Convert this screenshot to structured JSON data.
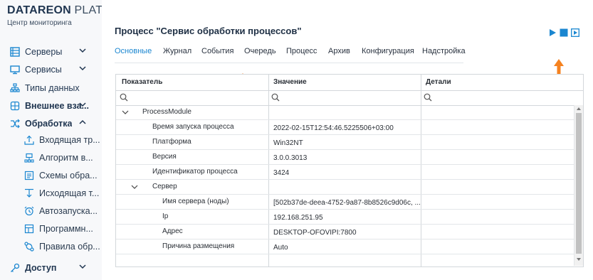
{
  "brand": {
    "name_bold": "DATAREON",
    "name_rest": "PLATF",
    "subtitle": "Центр мониторинга"
  },
  "sidebar": {
    "items": [
      {
        "label": "Серверы",
        "icon": "server-list-icon",
        "chevron": "down"
      },
      {
        "label": "Сервисы",
        "icon": "monitor-icon",
        "chevron": "down"
      },
      {
        "label": "Типы данных",
        "icon": "hierarchy-icon"
      },
      {
        "label": "Внешнее вза...",
        "icon": "puzzle-icon",
        "chevron": "down"
      },
      {
        "label": "Обработка",
        "icon": "shuffle-icon",
        "chevron": "up"
      },
      {
        "label": "Доступ",
        "icon": "key-icon",
        "chevron": "down"
      }
    ],
    "processing_children": [
      {
        "label": "Входящая тр...",
        "icon": "upload-icon"
      },
      {
        "label": "Алгоритм в...",
        "icon": "algorithm-icon"
      },
      {
        "label": "Схемы обра...",
        "icon": "scheme-icon"
      },
      {
        "label": "Исходящая т...",
        "icon": "download-icon"
      },
      {
        "label": "Автозапуска...",
        "icon": "alarm-icon"
      },
      {
        "label": "Программн...",
        "icon": "grid-icon"
      },
      {
        "label": "Правила обр...",
        "icon": "rules-icon"
      }
    ]
  },
  "page": {
    "title": "Процесс \"Сервис обработки процессов\""
  },
  "tabs": [
    "Основные",
    "Журнал",
    "События",
    "Очередь",
    "Процесс",
    "Архив",
    "Конфигурация",
    "Надстройка"
  ],
  "active_tab": "Основные",
  "controls": {
    "play": "play-icon",
    "stop": "stop-icon",
    "step": "step-play-icon"
  },
  "grid": {
    "columns": [
      "Показатель",
      "Значение",
      "Детали"
    ],
    "rows": [
      {
        "indicator": "ProcessModule",
        "value": "",
        "level": 0,
        "expandable": true
      },
      {
        "indicator": "Время запуска процесса",
        "value": "2022-02-15T12:54:46.5225506+03:00",
        "level": 1
      },
      {
        "indicator": "Платформа",
        "value": "Win32NT",
        "level": 1
      },
      {
        "indicator": "Версия",
        "value": "3.0.0.3013",
        "level": 1
      },
      {
        "indicator": "Идентификатор процесса",
        "value": "3424",
        "level": 1
      },
      {
        "indicator": "Сервер",
        "value": "",
        "level": 1,
        "expandable": true
      },
      {
        "indicator": "Имя сервера (ноды)",
        "value": "[502b37de-deea-4752-9a87-8b8526c9d06c, ...",
        "level": 2
      },
      {
        "indicator": "Ip",
        "value": "192.168.251.95",
        "level": 2
      },
      {
        "indicator": "Адрес",
        "value": "DESKTOP-OFOVIPI:7800",
        "level": 2
      },
      {
        "indicator": "Причина размещения",
        "value": "Auto",
        "level": 2
      },
      {
        "indicator": "",
        "value": "",
        "level": 0
      }
    ]
  },
  "colors": {
    "accent": "#1a86d0",
    "arrow": "#f58220",
    "brand": "#1f3550"
  }
}
